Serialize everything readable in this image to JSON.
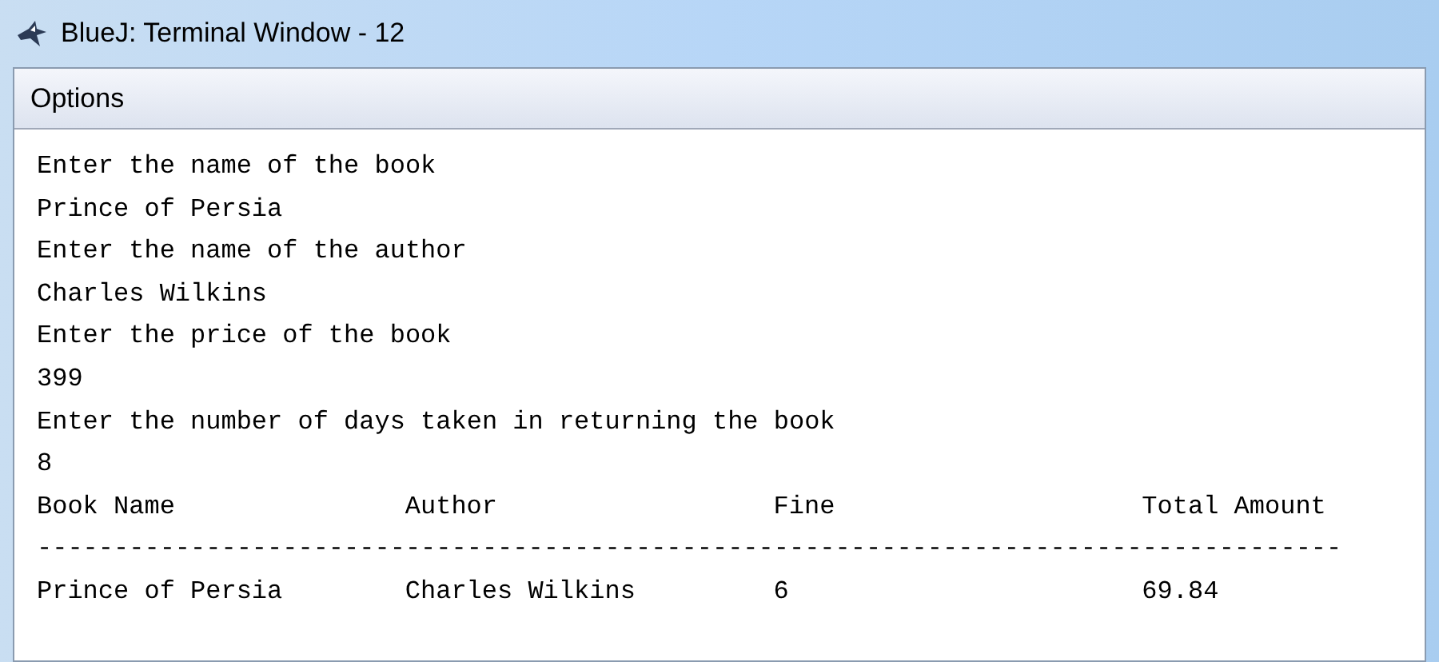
{
  "window": {
    "title": "BlueJ: Terminal Window - 12"
  },
  "menu": [
    {
      "label": "Options"
    }
  ],
  "output_lines": [
    "Enter the name of the book",
    "Prince of Persia",
    "Enter the name of the author",
    "Charles Wilkins",
    "Enter the price of the book",
    "399",
    "Enter the number of days taken in returning the book",
    "8"
  ],
  "table": {
    "columns": [
      "Book Name",
      "Author",
      "Fine",
      "Total Amount"
    ],
    "separator": "-------------------------------------------------------------------------------------",
    "rows": [
      [
        "Prince of Persia",
        "Charles Wilkins",
        "6",
        "69.84"
      ]
    ]
  }
}
